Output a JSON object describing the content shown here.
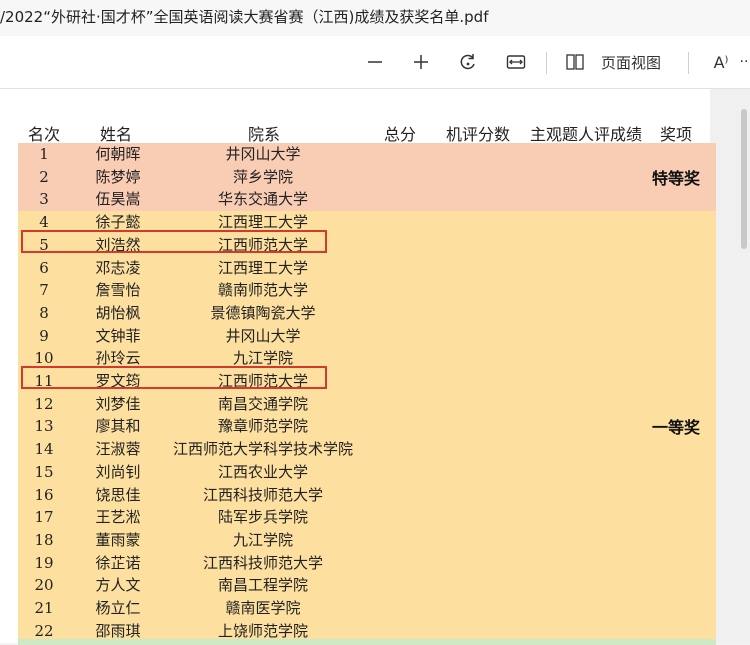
{
  "window": {
    "title": "/2022“外研社·国才杯”全国英语阅读大赛省赛（江西)成绩及获奖名单.pdf"
  },
  "toolbar": {
    "zoom_out_icon": "minus-icon",
    "zoom_in_icon": "plus-icon",
    "rotate_icon": "rotate-icon",
    "fit_icon": "fit-width-icon",
    "page_view_label": "页面视图",
    "read_aloud_label": "A⁾",
    "more_label": "··"
  },
  "table": {
    "headers": {
      "rank": "名次",
      "name": "姓名",
      "school": "院系",
      "total": "总分",
      "machine": "机评分数",
      "subjective": "主观题人评成绩",
      "award": "奖项"
    },
    "rows": [
      {
        "rank": "1",
        "name": "何朝晖",
        "school": "井冈山大学"
      },
      {
        "rank": "2",
        "name": "陈梦婷",
        "school": "萍乡学院"
      },
      {
        "rank": "3",
        "name": "伍昊嵩",
        "school": "华东交通大学"
      },
      {
        "rank": "4",
        "name": "徐子懿",
        "school": "江西理工大学"
      },
      {
        "rank": "5",
        "name": "刘浩然",
        "school": "江西师范大学"
      },
      {
        "rank": "6",
        "name": "邓志凌",
        "school": "江西理工大学"
      },
      {
        "rank": "7",
        "name": "詹雪怡",
        "school": "赣南师范大学"
      },
      {
        "rank": "8",
        "name": "胡怡枫",
        "school": "景德镇陶瓷大学"
      },
      {
        "rank": "9",
        "name": "文钟菲",
        "school": "井冈山大学"
      },
      {
        "rank": "10",
        "name": "孙玲云",
        "school": "九江学院"
      },
      {
        "rank": "11",
        "name": "罗文筠",
        "school": "江西师范大学"
      },
      {
        "rank": "12",
        "name": "刘梦佳",
        "school": "南昌交通学院"
      },
      {
        "rank": "13",
        "name": "廖其和",
        "school": "豫章师范学院"
      },
      {
        "rank": "14",
        "name": "汪淑蓉",
        "school": "江西师范大学科学技术学院"
      },
      {
        "rank": "15",
        "name": "刘尚钊",
        "school": "江西农业大学"
      },
      {
        "rank": "16",
        "name": "饶思佳",
        "school": "江西科技师范大学"
      },
      {
        "rank": "17",
        "name": "王艺淞",
        "school": "陆军步兵学院"
      },
      {
        "rank": "18",
        "name": "董雨蒙",
        "school": "九江学院"
      },
      {
        "rank": "19",
        "name": "徐芷诺",
        "school": "江西科技师范大学"
      },
      {
        "rank": "20",
        "name": "方人文",
        "school": "南昌工程学院"
      },
      {
        "rank": "21",
        "name": "杨立仁",
        "school": "赣南医学院"
      },
      {
        "rank": "22",
        "name": "邵雨琪",
        "school": "上饶师范学院"
      }
    ],
    "awards": {
      "special": "特等奖",
      "first": "一等奖"
    }
  },
  "colors": {
    "special_band": "#f9ccb4",
    "first_band": "#fde0a0",
    "highlight_box": "#d23b2b"
  }
}
